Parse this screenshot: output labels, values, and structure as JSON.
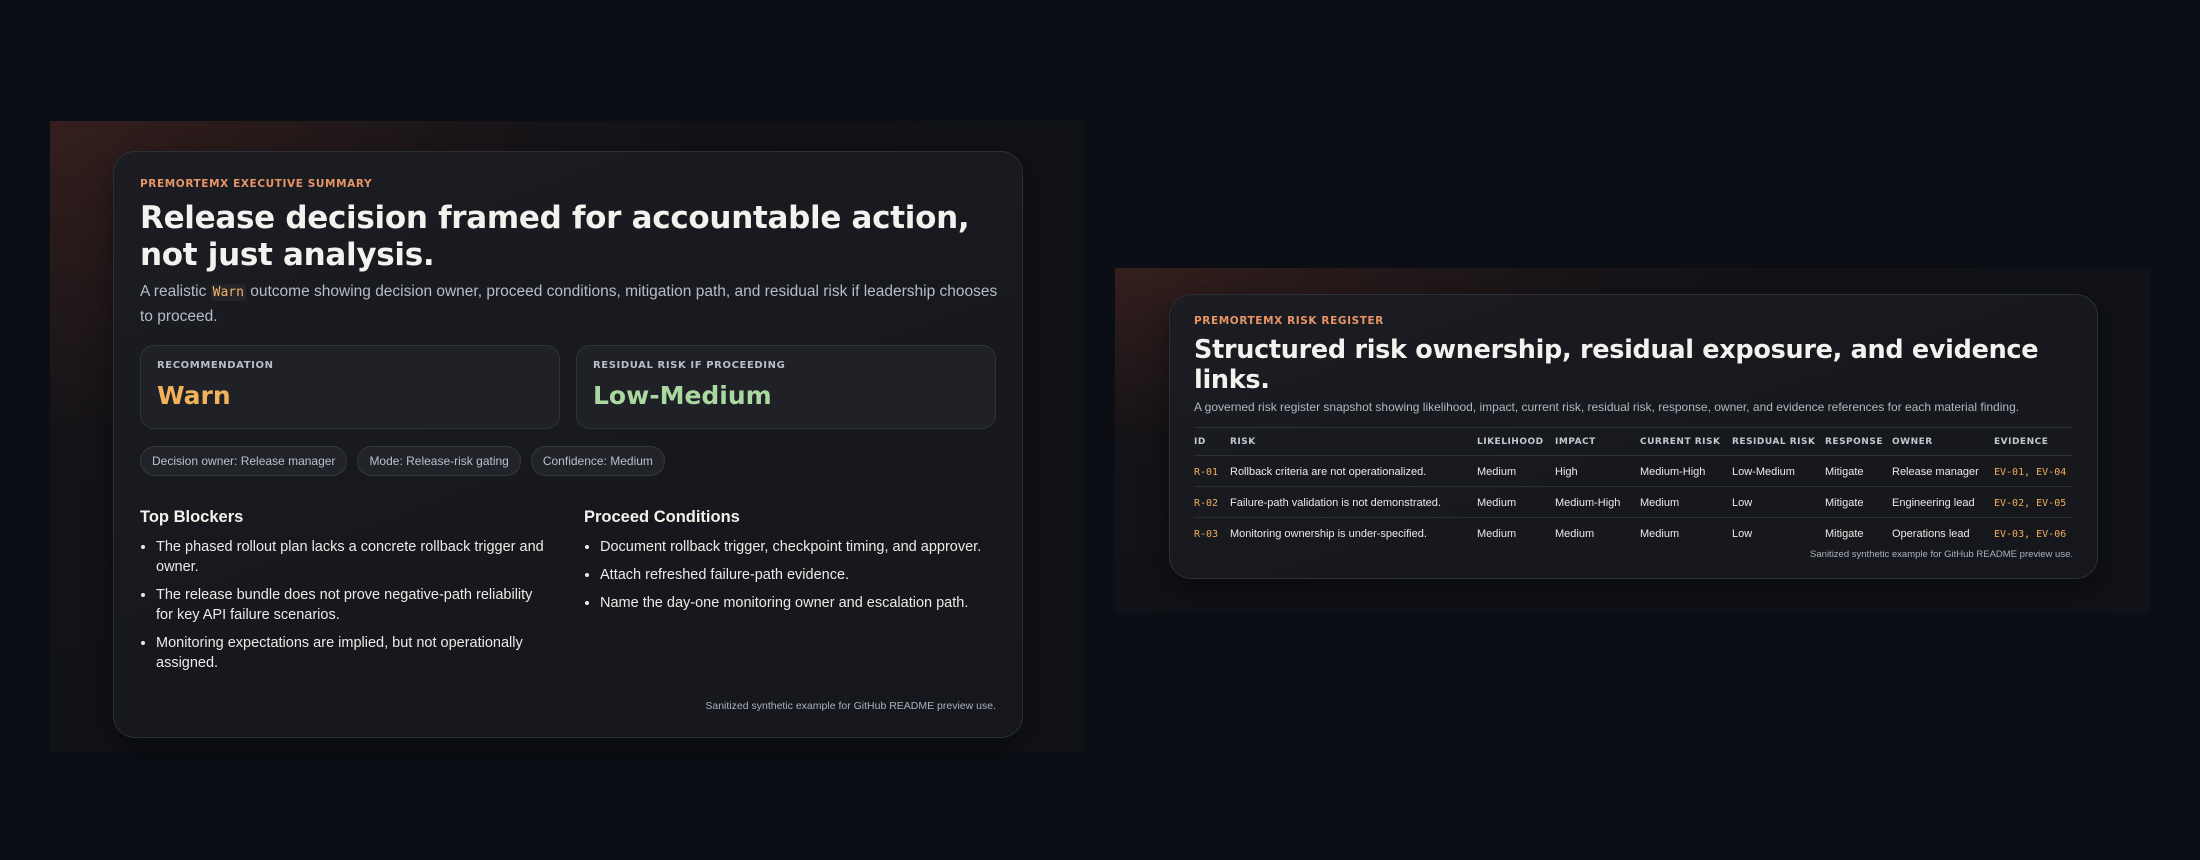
{
  "left": {
    "eyebrow": "PREMORTEMX EXECUTIVE SUMMARY",
    "title": "Release decision framed for accountable action, not just analysis.",
    "subtitle_pre": "A realistic ",
    "subtitle_code": "Warn",
    "subtitle_post": " outcome showing decision owner, proceed conditions, mitigation path, and residual risk if leadership chooses to proceed.",
    "stats": [
      {
        "label": "RECOMMENDATION",
        "value": "Warn"
      },
      {
        "label": "RESIDUAL RISK IF PROCEEDING",
        "value": "Low-Medium"
      }
    ],
    "pills": [
      "Decision owner: Release manager",
      "Mode: Release-risk gating",
      "Confidence: Medium"
    ],
    "blockers_title": "Top Blockers",
    "blockers": [
      "The phased rollout plan lacks a concrete rollback trigger and owner.",
      "The release bundle does not prove negative-path reliability for key API failure scenarios.",
      "Monitoring expectations are implied, but not operationally assigned."
    ],
    "conditions_title": "Proceed Conditions",
    "conditions": [
      "Document rollback trigger, checkpoint timing, and approver.",
      "Attach refreshed failure-path evidence.",
      "Name the day-one monitoring owner and escalation path."
    ],
    "footnote": "Sanitized synthetic example for GitHub README preview use."
  },
  "right": {
    "eyebrow": "PREMORTEMX RISK REGISTER",
    "title": "Structured risk ownership, residual exposure, and evidence links.",
    "subtitle": "A governed risk register snapshot showing likelihood, impact, current risk, residual risk, response, owner, and evidence references for each material finding.",
    "columns": [
      "ID",
      "RISK",
      "LIKELIHOOD",
      "IMPACT",
      "CURRENT RISK",
      "RESIDUAL RISK",
      "RESPONSE",
      "OWNER",
      "EVIDENCE"
    ],
    "rows": [
      [
        "R-01",
        "Rollback criteria are not operationalized.",
        "Medium",
        "High",
        "Medium-High",
        "Low-Medium",
        "Mitigate",
        "Release manager",
        "EV-01, EV-04"
      ],
      [
        "R-02",
        "Failure-path validation is not demonstrated.",
        "Medium",
        "Medium-High",
        "Medium",
        "Low",
        "Mitigate",
        "Engineering lead",
        "EV-02, EV-05"
      ],
      [
        "R-03",
        "Monitoring ownership is under-specified.",
        "Medium",
        "Medium",
        "Medium",
        "Low",
        "Mitigate",
        "Operations lead",
        "EV-03, EV-06"
      ]
    ],
    "footnote": "Sanitized synthetic example for GitHub README preview use."
  },
  "colors": {
    "background": "#0b0f15",
    "eyebrow": "#e89566",
    "warn": "#f2b25c",
    "low_medium": "#a9d9a0"
  }
}
